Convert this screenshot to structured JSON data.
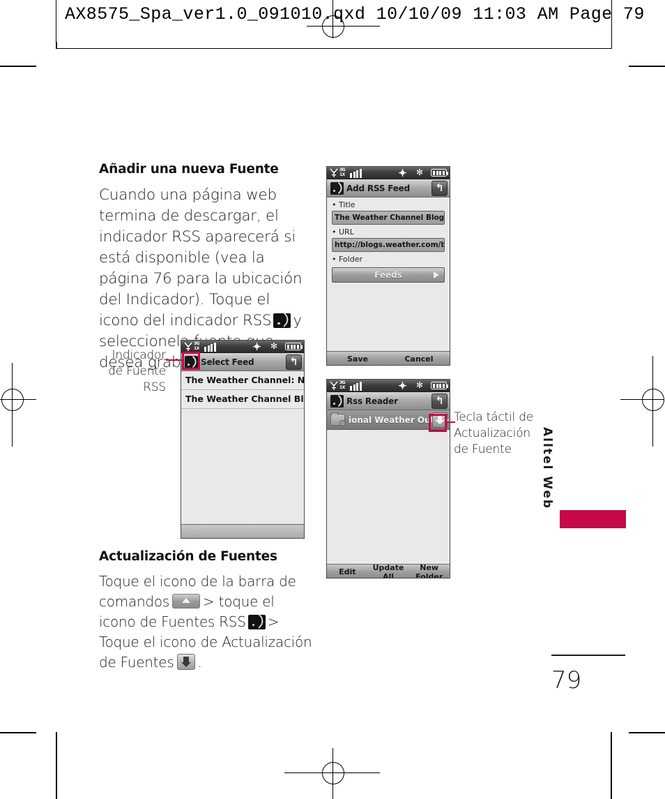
{
  "slug": {
    "text": "AX8575_Spa_ver1.0_091010.qxd   10/10/09   11:03 AM   Page 79"
  },
  "sections": [
    {
      "heading": "Añadir una nueva Fuente",
      "paragraph_before_icon": "Cuando una página web termina de descargar, el indicador RSS aparecerá si está disponible (vea la página 76 para la ubicación del Indicador). Toque el icono del indicador RSS",
      "icon": "rss-feed-icon",
      "paragraph_after_icon": "y seleccionela fuente que desea grabar."
    },
    {
      "heading": "Actualización de Fuentes",
      "part1": "Toque el icono de la barra de comandos",
      "icon1": "command-bar-icon",
      "part2": "> toque el icono de Fuentes RSS",
      "icon2": "rss-feed-icon",
      "part3": "> Toque el icono de Actualización de Fuentes",
      "icon3": "feed-update-icon",
      "part4": "."
    }
  ],
  "callouts": [
    {
      "name": "rss-feed-indicator",
      "lines": [
        "Indicador",
        "de Fuente",
        "RSS"
      ],
      "align": "right",
      "color": "#c6094a"
    },
    {
      "name": "feed-update-touch-key",
      "lines": [
        "Tecla táctil de",
        "Actualización",
        "de Fuente"
      ],
      "align": "left",
      "color": "#c6094a"
    }
  ],
  "phones": [
    {
      "id": "add-rss-feed",
      "statusbar": {
        "network_top": "3G",
        "network_bottom": "1X",
        "signal_bars": 4,
        "icons": [
          "antenna-icon",
          "gps-icon",
          "bluetooth-icon",
          "battery-icon"
        ]
      },
      "title": "Add RSS Feed",
      "title_icon": "rss-icon",
      "back_icon": "back-arrow-icon",
      "fields": [
        {
          "label": "Title",
          "value": "The Weather Channel Blog [RSS"
        },
        {
          "label": "URL",
          "value": "http://blogs.weather.com/blog"
        },
        {
          "label": "Folder",
          "value": "Feeds",
          "type": "select"
        }
      ],
      "softkeys": [
        "Save",
        "Cancel"
      ]
    },
    {
      "id": "select-feed",
      "statusbar": {
        "network_top": "3G",
        "network_bottom": "1X",
        "signal_bars": 4,
        "icons": [
          "antenna-icon",
          "gps-icon",
          "bluetooth-icon",
          "battery-icon"
        ]
      },
      "title": "Select Feed",
      "title_icon": "rss-icon",
      "back_icon": "back-arrow-icon",
      "list": [
        "The Weather Channel:  Nati",
        "The Weather Channel Blog"
      ],
      "softkeys": []
    },
    {
      "id": "rss-reader",
      "statusbar": {
        "network_top": "3G",
        "network_bottom": "1X",
        "signal_bars": 4,
        "icons": [
          "antenna-icon",
          "gps-icon",
          "bluetooth-icon",
          "battery-icon"
        ]
      },
      "title": "Rss Reader",
      "title_icon": "rss-icon",
      "back_icon": "back-arrow-icon",
      "feed_row": {
        "icon": "folder-rss-icon",
        "text": "ional Weather Outlook",
        "button_icon": "download-update-icon"
      },
      "softkeys": [
        "Edit",
        "Update All",
        "New Folder"
      ]
    }
  ],
  "margin": {
    "chapter_tab": "Alltel Web",
    "tab_color": "#c6094a",
    "page_number": "79"
  }
}
